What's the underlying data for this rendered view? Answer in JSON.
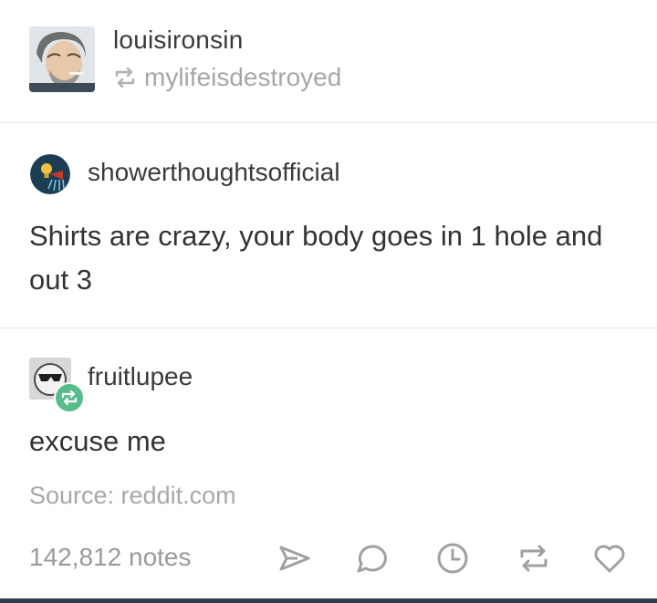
{
  "header": {
    "username": "louisironsin",
    "reblogged_from": "mylifeisdestroyed"
  },
  "original_post": {
    "blog_name": "showerthoughtsofficial",
    "text": "Shirts are crazy, your body goes in 1 hole and out 3"
  },
  "reblog": {
    "blog_name": "fruitlupee",
    "text": "excuse me",
    "source": "Source: reddit.com"
  },
  "footer": {
    "notes": "142,812 notes",
    "actions": [
      "share-icon",
      "reply-icon",
      "clock-icon",
      "reblog-icon",
      "heart-icon"
    ]
  },
  "colors": {
    "text": "#333333",
    "muted": "#a8a8a8",
    "divider": "#e5e5e5",
    "reblog_badge": "#56bc8a",
    "bottom_bar": "#2e3c4e"
  }
}
